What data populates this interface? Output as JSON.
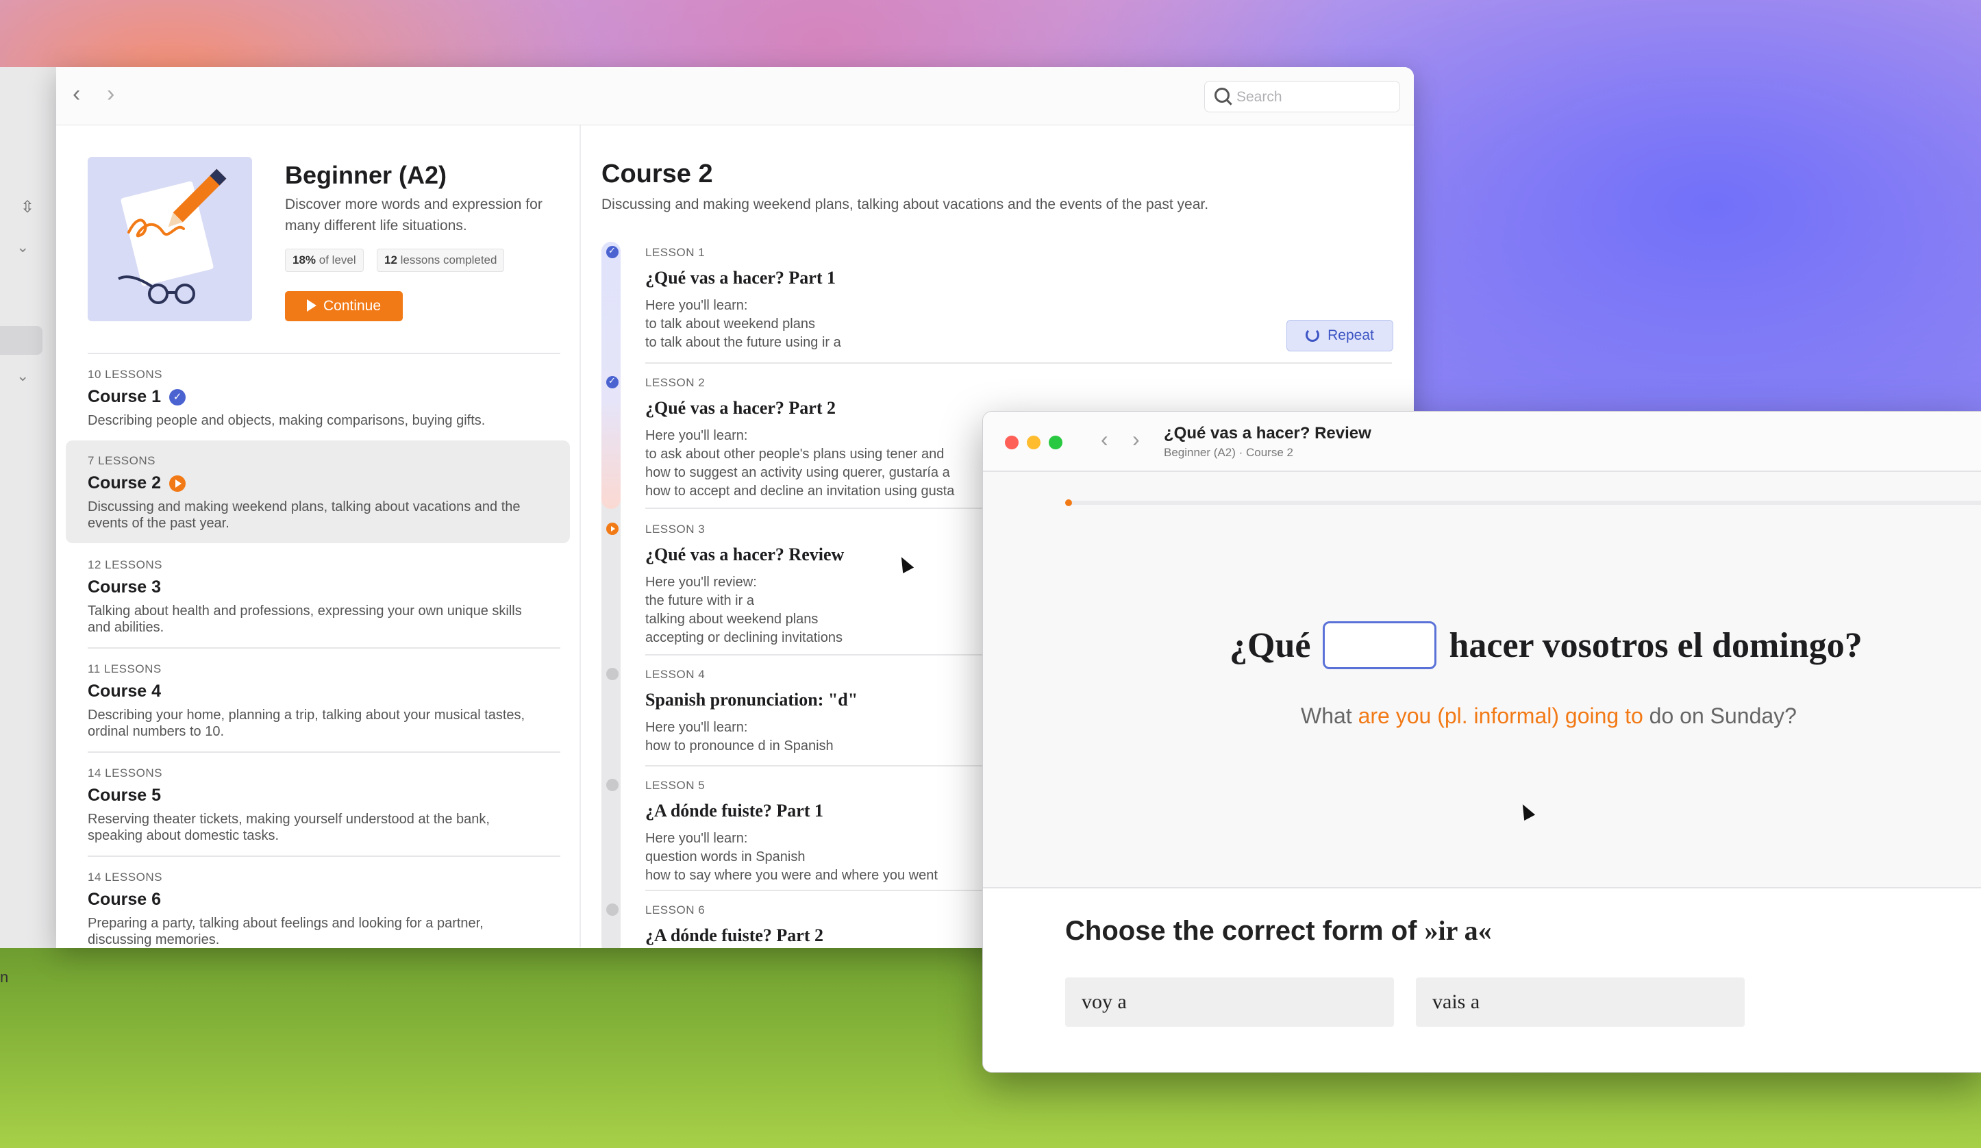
{
  "sidebar_fragment": {
    "text": "n"
  },
  "main_window": {
    "search": {
      "placeholder": "Search"
    },
    "level": {
      "title": "Beginner (A2)",
      "description": "Discover more words and expression for many different life situations.",
      "progress_value": "18%",
      "progress_suffix": "of level",
      "lessons_value": "12",
      "lessons_suffix": "lessons completed",
      "continue_label": "Continue"
    },
    "courses": [
      {
        "count": "10 LESSONS",
        "name": "Course 1",
        "status": "completed",
        "desc": "Describing people and objects, making comparisons, buying gifts."
      },
      {
        "count": "7 LESSONS",
        "name": "Course 2",
        "status": "in-progress",
        "desc": "Discussing and making weekend plans, talking about vacations and the events of the past year."
      },
      {
        "count": "12 LESSONS",
        "name": "Course 3",
        "status": "",
        "desc": "Talking about health and professions, expressing your own unique skills and abilities."
      },
      {
        "count": "11 LESSONS",
        "name": "Course 4",
        "status": "",
        "desc": "Describing your home, planning a trip, talking about your musical tastes, ordinal numbers to 10."
      },
      {
        "count": "14 LESSONS",
        "name": "Course 5",
        "status": "",
        "desc": "Reserving theater tickets, making yourself understood at the bank, speaking about domestic tasks."
      },
      {
        "count": "14 LESSONS",
        "name": "Course 6",
        "status": "",
        "desc": "Preparing a party, talking about feelings and looking for a partner, discussing memories."
      }
    ],
    "course_detail": {
      "title": "Course 2",
      "description": "Discussing and making weekend plans, talking about vacations and the events of the past year.",
      "repeat_label": "Repeat",
      "lessons": [
        {
          "num": "LESSON 1",
          "title": "¿Qué vas a hacer? Part 1",
          "status": "completed",
          "lines": [
            "Here you'll learn:",
            "to talk about weekend plans",
            "to talk about the future using ir a"
          ]
        },
        {
          "num": "LESSON 2",
          "title": "¿Qué vas a hacer? Part 2",
          "status": "completed",
          "lines": [
            "Here you'll learn:",
            "to ask about other people's plans using tener and",
            "how to suggest an activity using querer, gustaría a",
            "how to accept and decline an invitation using gusta"
          ]
        },
        {
          "num": "LESSON 3",
          "title": "¿Qué vas a hacer? Review",
          "status": "current",
          "lines": [
            "Here you'll review:",
            "the future with ir a",
            "talking about weekend plans",
            "accepting or declining invitations"
          ]
        },
        {
          "num": "LESSON 4",
          "title": "Spanish pronunciation: \"d\"",
          "status": "todo",
          "lines": [
            "Here you'll learn:",
            "how to pronounce d in Spanish"
          ]
        },
        {
          "num": "LESSON 5",
          "title": "¿A dónde fuiste? Part 1",
          "status": "todo",
          "lines": [
            "Here you'll learn:",
            "question words in Spanish",
            "how to say where you were and where you went"
          ]
        },
        {
          "num": "LESSON 6",
          "title": "¿A dónde fuiste? Part 2",
          "status": "todo",
          "lines": []
        }
      ]
    }
  },
  "review_window": {
    "title": "¿Qué vas a hacer? Review",
    "subtitle": "Beginner (A2) · Course 2",
    "progress": 0.005,
    "question_before": "¿Qué",
    "question_after": "hacer vosotros el domingo?",
    "translation_before": "What ",
    "translation_highlight": "are you (pl. informal) going to",
    "translation_after": " do on Sunday?",
    "instruction": "Choose the correct form of ",
    "instruction_term": "»ir a«",
    "options": [
      "voy a",
      "vais a"
    ]
  },
  "colors": {
    "accent": "#f27a16",
    "primary": "#4b63d1"
  }
}
